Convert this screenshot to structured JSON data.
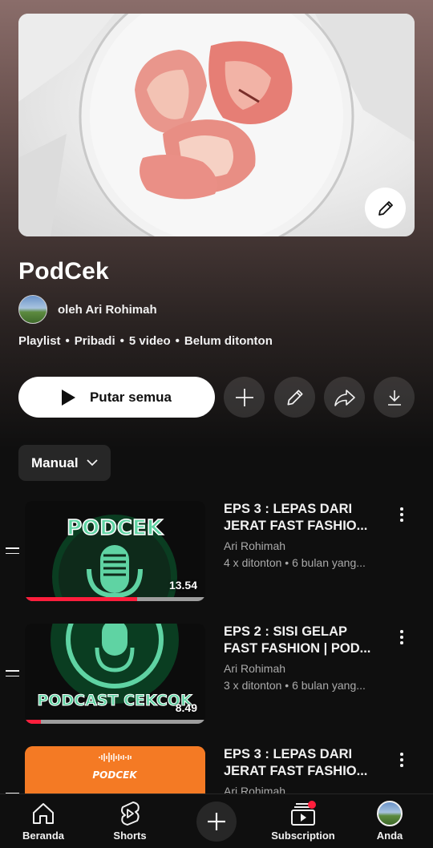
{
  "playlist": {
    "title": "PodCek",
    "owner": "oleh Ari Rohimah",
    "meta": [
      "Playlist",
      "Pribadi",
      "5 video",
      "Belum ditonton"
    ]
  },
  "actions": {
    "play_all": "Putar semua",
    "icons": [
      "add-icon",
      "edit-icon",
      "share-icon",
      "download-icon"
    ]
  },
  "sort": {
    "label": "Manual"
  },
  "videos": [
    {
      "title_line1": "EPS 3 : LEPAS DARI",
      "title_line2": "JERAT FAST FASHIO...",
      "channel": "Ari Rohimah",
      "stats": "4 x ditonton • 6 bulan yang...",
      "duration": "13.54",
      "progress": 0.62,
      "thumb_text": "PODCEK"
    },
    {
      "title_line1": "EPS 2 : SISI GELAP",
      "title_line2": "FAST FASHION | POD...",
      "channel": "Ari Rohimah",
      "stats": "3 x ditonton • 6 bulan yang...",
      "duration": "8.49",
      "progress": 0.09,
      "thumb_text": "PODCAST CEKCOK"
    },
    {
      "title_line1": "EPS 3 : LEPAS DARI",
      "title_line2": "JERAT FAST FASHIO...",
      "channel": "Ari Rohimah",
      "thumb_text": "PODCEK"
    }
  ],
  "nav": {
    "home": "Beranda",
    "shorts": "Shorts",
    "subscriptions": "Subscription",
    "you": "Anda"
  },
  "colors": {
    "accent_red": "#ff1e3c",
    "mint": "#5fd3a3",
    "orange": "#f47a24"
  }
}
